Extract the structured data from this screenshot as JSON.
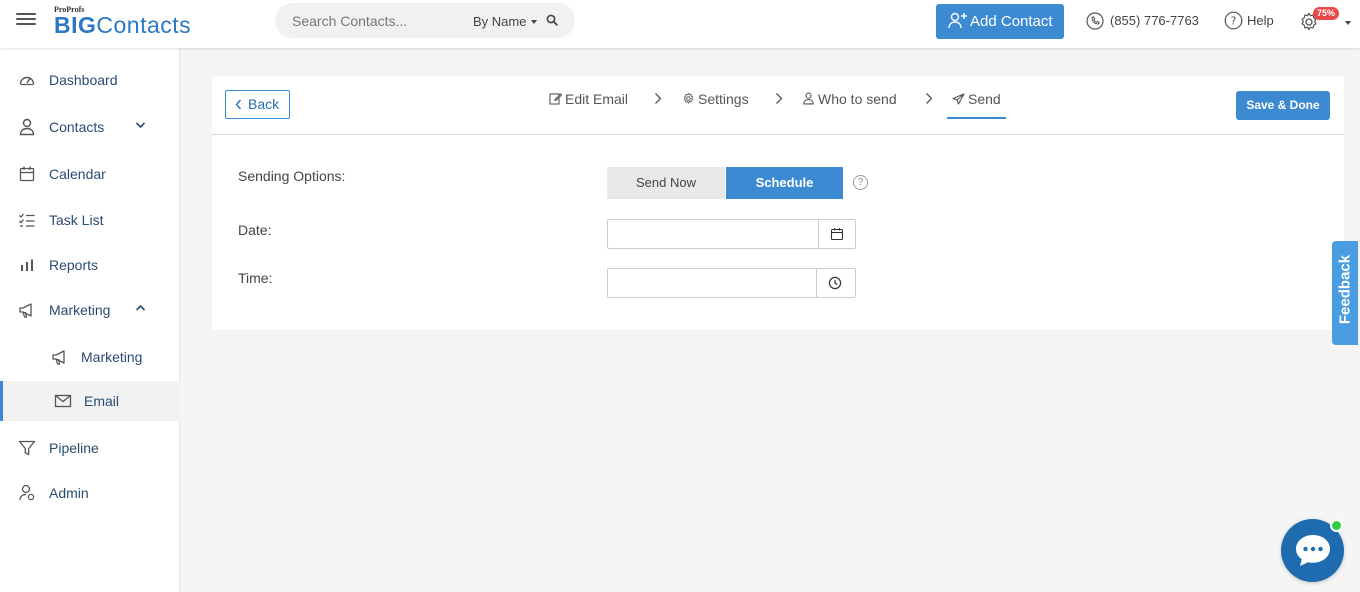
{
  "brand": {
    "small": "ProProfs",
    "big_bold": "BIG",
    "big_thin": "Contacts"
  },
  "search": {
    "placeholder": "Search Contacts...",
    "filter_label": "By Name"
  },
  "header": {
    "add_contact_label": "Add Contact",
    "phone": "(855) 776-7763",
    "help_label": "Help",
    "settings_badge": "75%"
  },
  "sidebar": {
    "items": [
      {
        "label": "Dashboard",
        "icon": "dashboard-icon"
      },
      {
        "label": "Contacts",
        "icon": "user-icon"
      },
      {
        "label": "Calendar",
        "icon": "calendar-icon"
      },
      {
        "label": "Task List",
        "icon": "task-list-icon"
      },
      {
        "label": "Reports",
        "icon": "bar-chart-icon"
      },
      {
        "label": "Marketing",
        "icon": "megaphone-icon"
      },
      {
        "label": "Marketing",
        "icon": "megaphone-icon"
      },
      {
        "label": "Email",
        "icon": "envelope-icon"
      },
      {
        "label": "Pipeline",
        "icon": "funnel-icon"
      },
      {
        "label": "Admin",
        "icon": "admin-icon"
      }
    ]
  },
  "wizard": {
    "back_label": "Back",
    "steps": [
      {
        "label": "Edit Email",
        "icon": "edit-icon"
      },
      {
        "label": "Settings",
        "icon": "gear-icon"
      },
      {
        "label": "Who to send",
        "icon": "user-icon"
      },
      {
        "label": "Send",
        "icon": "paper-plane-icon"
      }
    ],
    "active_step": "Send",
    "save_label": "Save & Done"
  },
  "form": {
    "sending_options_label": "Sending Options:",
    "send_now_label": "Send Now",
    "schedule_label": "Schedule",
    "selected_option": "Schedule",
    "date_label": "Date:",
    "date_value": "",
    "time_label": "Time:",
    "time_value": ""
  },
  "feedback_label": "Feedback",
  "colors": {
    "accent": "#3c8ad2",
    "nav_text": "#2a4a72",
    "badge": "#e84a4a",
    "chat": "#1f6bb0",
    "online": "#2ecc40"
  }
}
